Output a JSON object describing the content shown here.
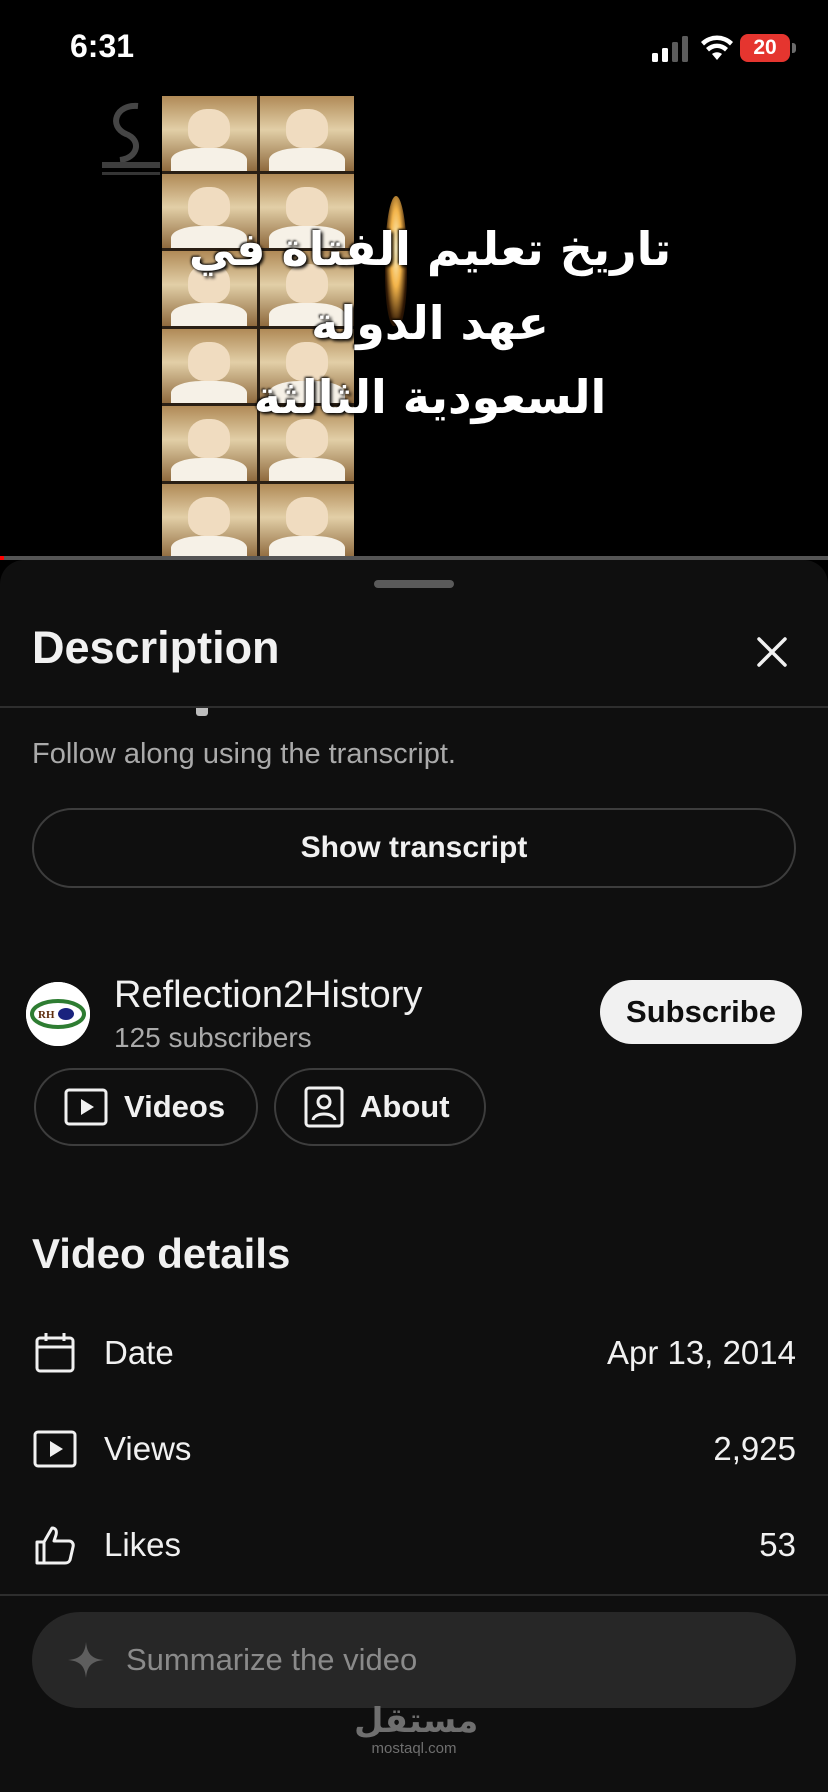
{
  "status_bar": {
    "time": "6:31",
    "battery": "20",
    "icons": [
      "cellular-signal-icon",
      "wifi-icon",
      "battery-icon"
    ]
  },
  "video": {
    "title_line_1": "تاريخ تعليم الفتاة في",
    "title_line_2": "عهد الدولة",
    "title_line_3": "السعودية الثالثة",
    "progress": 0.002
  },
  "sheet": {
    "title": "Description",
    "close_icon": "close-icon",
    "transcript_hint": "Follow along using the transcript.",
    "show_transcript_label": "Show transcript"
  },
  "channel": {
    "avatar_text": "RH",
    "name": "Reflection2History",
    "subscribers": "125 subscribers",
    "subscribe_label": "Subscribe",
    "videos_label": "Videos",
    "about_label": "About"
  },
  "video_details": {
    "title": "Video details",
    "rows": [
      {
        "icon": "calendar-icon",
        "label": "Date",
        "value": "Apr 13, 2014"
      },
      {
        "icon": "play-icon",
        "label": "Views",
        "value": "2,925"
      },
      {
        "icon": "thumbs-up-icon",
        "label": "Likes",
        "value": "53"
      }
    ]
  },
  "summarize": {
    "placeholder": "Summarize the video",
    "icon": "sparkle-icon"
  },
  "watermark": {
    "arabic": "مستقل",
    "latin": "mostaql.com"
  },
  "colors": {
    "sheet_bg": "#0f0f0f",
    "battery": "#e5352f",
    "subscribe_bg": "#f1f1f1",
    "summarize_bg": "#272727"
  }
}
